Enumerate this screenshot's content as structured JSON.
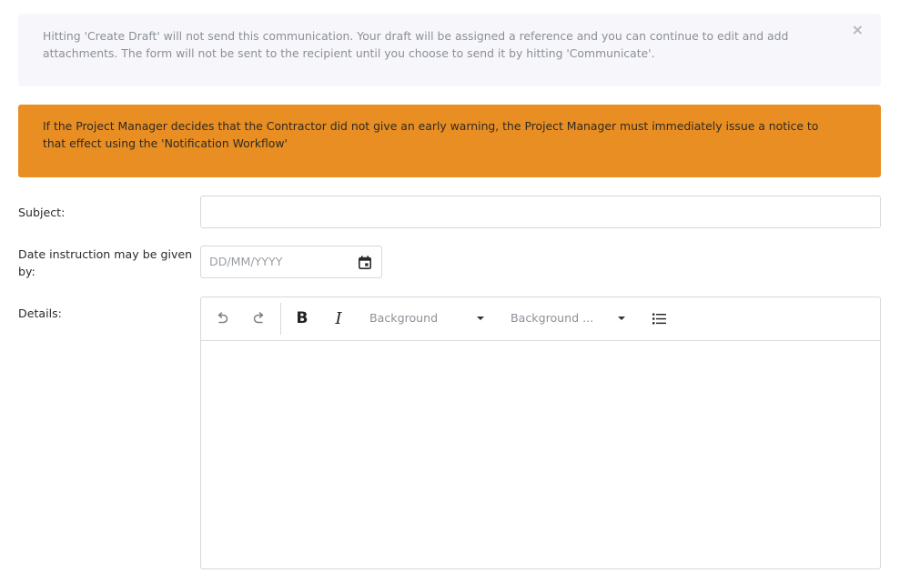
{
  "info_alert": {
    "text_line1": "Hitting 'Create Draft' will not send this communication. Your draft will be assigned a reference and you can continue to edit and add",
    "text_line2": "attachments. The form will not be sent to the recipient until you choose to send it by hitting 'Communicate'.",
    "close_label": "×"
  },
  "warning_alert": {
    "text_line1": "If the Project Manager decides that the Contractor did not give an early warning, the Project Manager must immediately issue a notice to",
    "text_line2": "that effect using the 'Notification Workflow'",
    "background_color": "#e88e22"
  },
  "form": {
    "subject": {
      "label": "Subject:",
      "value": ""
    },
    "date": {
      "label_line1": "Date instruction may be given",
      "label_line2": "by:",
      "placeholder": "DD/MM/YYYY",
      "icon": "calendar-icon"
    },
    "details": {
      "label": "Details:",
      "toolbar": {
        "undo_icon": "undo-icon",
        "redo_icon": "redo-icon",
        "bold_label": "B",
        "italic_label": "I",
        "dropdown1_label": "Background",
        "dropdown2_label": "Background ...",
        "list_icon": "bullet-list-icon"
      },
      "content": ""
    }
  }
}
